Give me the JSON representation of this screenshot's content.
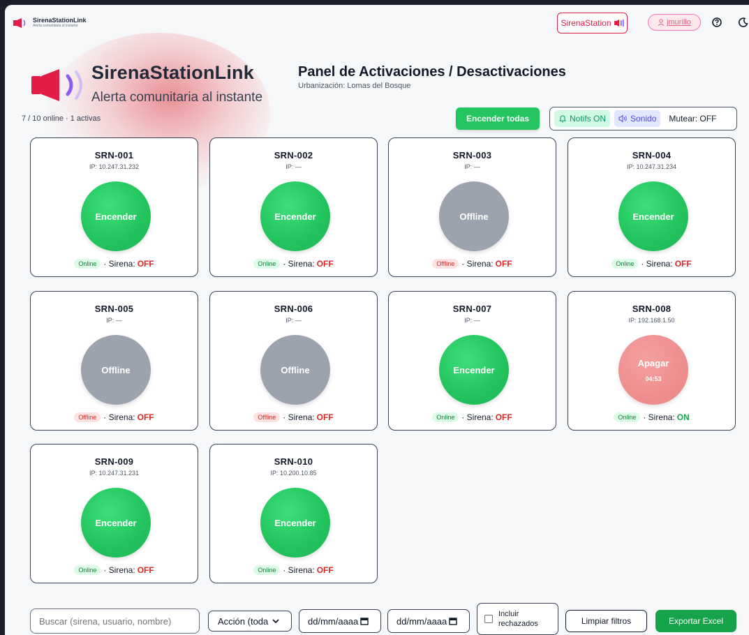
{
  "app": {
    "brand_name": "SirenaStationLink",
    "brand_tagline": "Alerta comunitaria al instante"
  },
  "topbar": {
    "station_label": "SirenaStation",
    "user_label": "jmurillo"
  },
  "panel": {
    "title": "Panel de Activaciones / Desactivaciones",
    "subtitle": "Urbanización: Lomas del Bosque",
    "online_summary": "7 / 10 online · 1 activas"
  },
  "controls": {
    "all_on_label": "Encender todas",
    "notifs_label": "Notifs ON",
    "sound_label": "Sonido",
    "mute_label": "Mutear: OFF"
  },
  "status_words": {
    "siren_prefix": "· Sirena:"
  },
  "sirens": [
    {
      "name": "SRN-001",
      "ip": "IP: 10.247.31.232",
      "button": "Encender",
      "timer": "",
      "badge": "Online",
      "siren_state": "OFF",
      "kind": "on"
    },
    {
      "name": "SRN-002",
      "ip": "IP: —",
      "button": "Encender",
      "timer": "",
      "badge": "Online",
      "siren_state": "OFF",
      "kind": "on"
    },
    {
      "name": "SRN-003",
      "ip": "IP: —",
      "button": "Offline",
      "timer": "",
      "badge": "Offline",
      "siren_state": "OFF",
      "kind": "offline"
    },
    {
      "name": "SRN-004",
      "ip": "IP: 10.247.31.234",
      "button": "Encender",
      "timer": "",
      "badge": "Online",
      "siren_state": "OFF",
      "kind": "on"
    },
    {
      "name": "SRN-005",
      "ip": "IP: —",
      "button": "Offline",
      "timer": "",
      "badge": "Offline",
      "siren_state": "OFF",
      "kind": "offline"
    },
    {
      "name": "SRN-006",
      "ip": "IP: —",
      "button": "Offline",
      "timer": "",
      "badge": "Offline",
      "siren_state": "OFF",
      "kind": "offline"
    },
    {
      "name": "SRN-007",
      "ip": "IP: —",
      "button": "Encender",
      "timer": "",
      "badge": "Online",
      "siren_state": "OFF",
      "kind": "on"
    },
    {
      "name": "SRN-008",
      "ip": "IP: 192.168.1.50",
      "button": "Apagar",
      "timer": "04:53",
      "badge": "Online",
      "siren_state": "ON",
      "kind": "active"
    },
    {
      "name": "SRN-009",
      "ip": "IP: 10.247.31.231",
      "button": "Encender",
      "timer": "",
      "badge": "Online",
      "siren_state": "OFF",
      "kind": "on"
    },
    {
      "name": "SRN-010",
      "ip": "IP: 10.200.10.85",
      "button": "Encender",
      "timer": "",
      "badge": "Online",
      "siren_state": "OFF",
      "kind": "on"
    }
  ],
  "filters": {
    "search_placeholder": "Buscar (sirena, usuario, nombre)",
    "action_select": "Acción (toda",
    "date_from": "dd/mm/aaaa",
    "date_to": "dd/mm/aaaa",
    "include_rejected": "Incluir rechazados",
    "clear_label": "Limpiar filtros",
    "export_label": "Exportar Excel"
  },
  "colors": {
    "accent_green": "#22c55e",
    "danger_red": "#dc2626",
    "offline_gray": "#9ca3af",
    "active_pink": "#ef8e8e"
  }
}
